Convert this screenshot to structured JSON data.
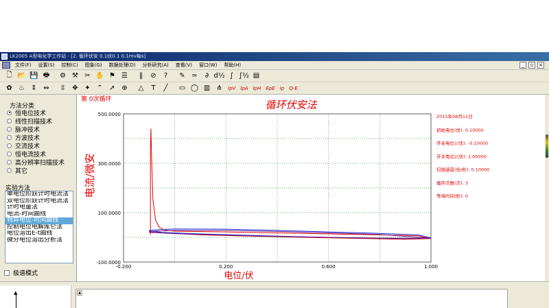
{
  "window": {
    "title": "LK2005 A型电化学工作站 - [2. 循环伏安  0.1伏0.1 0.1mv每s]"
  },
  "menu": [
    "文件(F)",
    "设置(S)",
    "控制(C)",
    "图象(G)",
    "数据处理(D)",
    "分析研究(A)",
    "查看(V)",
    "窗口(W)",
    "帮助(H)"
  ],
  "window_controls": [
    "_",
    "▫",
    "×"
  ],
  "toolbar1": [
    {
      "name": "new-file-icon",
      "glyph": "🗋"
    },
    {
      "name": "open-folder-icon",
      "glyph": "📂"
    },
    {
      "name": "save-icon",
      "glyph": "💾"
    },
    {
      "name": "print-icon",
      "glyph": "🖶"
    },
    {
      "name": "settings-icon",
      "glyph": "⚙"
    },
    {
      "name": "parameter-icon",
      "glyph": "⚒"
    },
    {
      "name": "tools-icon",
      "glyph": "✂"
    },
    {
      "name": "hand-icon",
      "glyph": "✋"
    },
    {
      "name": "flag-icon",
      "glyph": "⚑"
    },
    {
      "name": "runner-icon",
      "glyph": "☰"
    },
    {
      "name": "pause-icon",
      "glyph": "‖"
    },
    {
      "name": "stop-icon",
      "glyph": "⊘"
    },
    {
      "name": "help-icon",
      "glyph": "?"
    },
    {
      "name": "pen-icon",
      "glyph": "✎"
    },
    {
      "name": "smooth-icon",
      "glyph": "≃"
    },
    {
      "name": "derivative-icon",
      "glyph": "∂"
    },
    {
      "name": "half-derivative-icon",
      "glyph": "d½"
    },
    {
      "name": "integral-icon",
      "glyph": "∫"
    },
    {
      "name": "half-integral-icon",
      "glyph": "∫½"
    },
    {
      "name": "monitor-icon",
      "glyph": "▤"
    }
  ],
  "toolbar2": [
    {
      "name": "palette-icon",
      "glyph": "✿"
    },
    {
      "name": "lamp-icon",
      "glyph": "♨"
    },
    {
      "name": "axis-icon",
      "glyph": "⇕"
    },
    {
      "name": "move-horizontal-icon",
      "glyph": "⇔"
    },
    {
      "name": "move-vertical-icon",
      "glyph": "⇳"
    },
    {
      "name": "zoom-in-icon",
      "glyph": "✥"
    },
    {
      "name": "star-icon",
      "glyph": "✦"
    },
    {
      "name": "peak-icon",
      "glyph": "⌃"
    },
    {
      "name": "cursor-arrow-icon",
      "glyph": "➚"
    },
    {
      "name": "target-icon",
      "glyph": "⊕"
    },
    {
      "name": "triangle-icon",
      "glyph": "△"
    },
    {
      "name": "text-tool-icon",
      "glyph": "T"
    },
    {
      "name": "line-tool-icon",
      "glyph": "╱"
    },
    {
      "name": "rectangle-tool-icon",
      "glyph": "▭"
    },
    {
      "name": "ellipse-tool-icon",
      "glyph": "◯"
    },
    {
      "name": "chart-icon",
      "glyph": "▥"
    },
    {
      "name": "peak-find-icon",
      "glyph": "⋔"
    }
  ],
  "toolbar2_text_buttons": [
    "IpV",
    "IpA",
    "IpH",
    "EpE",
    "Ip",
    "Q-E"
  ],
  "left_panel": {
    "method_category_label": "方法分类",
    "method_categories": [
      {
        "label": "恒电位技术",
        "selected": true
      },
      {
        "label": "线性扫描技术",
        "selected": false
      },
      {
        "label": "脉冲技术",
        "selected": false
      },
      {
        "label": "方波技术",
        "selected": false
      },
      {
        "label": "交流技术",
        "selected": false
      },
      {
        "label": "恒电流技术",
        "selected": false
      },
      {
        "label": "高分辨率扫描技术",
        "selected": false
      },
      {
        "label": "其它",
        "selected": false
      }
    ],
    "experiment_label": "实验方法",
    "experiments": [
      {
        "label": "单电位阶跃计时电流法",
        "selected": false
      },
      {
        "label": "双电位阶跃计时电流法",
        "selected": false
      },
      {
        "label": "计时电量法",
        "selected": false
      },
      {
        "label": "电流-时间曲线",
        "selected": false
      },
      {
        "label": "特异电位-时间曲线",
        "selected": true
      },
      {
        "label": "控制电位电解库仑法",
        "selected": false
      },
      {
        "label": "电位溶出E-t曲线",
        "selected": false
      },
      {
        "label": "微分电位溶出分析法",
        "selected": false
      }
    ],
    "pole_mode_label": "极谱模式",
    "pole_mode_checked": false
  },
  "plot": {
    "cycle_label": "第 0次循环",
    "colors": {
      "red": "#e00000",
      "blue": "#1a2adb",
      "purple": "#6a1a8a",
      "grid": "#3a8a3a"
    }
  },
  "params": {
    "date": "2015年08月11日",
    "lines": [
      "初始电位(伏): 0.10000",
      "开关电位1(伏): -0.10000",
      "开关电位2(伏): 1.00000",
      "扫描速度(伏/秒): 0.10000",
      "循环次数(次): 3",
      "等待时间(秒): 0"
    ]
  },
  "chart_data": {
    "type": "line",
    "title": "循环伏安法",
    "xlabel": "电位/伏",
    "ylabel": "电流/微安",
    "xlim": [
      -0.2,
      1.0
    ],
    "ylim": [
      -100,
      500
    ],
    "x_ticks": [
      "-0.200",
      "0.200",
      "0.600",
      "1.000"
    ],
    "y_ticks": [
      "500.0000",
      "300.0000",
      "100.0000",
      "-100.0000"
    ],
    "grid": true,
    "series": [
      {
        "color": "#e00000",
        "points": [
          [
            -0.095,
            10
          ],
          [
            -0.095,
            20
          ],
          [
            -0.095,
            360
          ],
          [
            -0.093,
            440
          ],
          [
            -0.09,
            300
          ],
          [
            -0.085,
            150
          ],
          [
            -0.075,
            70
          ],
          [
            -0.06,
            40
          ],
          [
            -0.04,
            30
          ],
          [
            0.0,
            25
          ],
          [
            0.2,
            22
          ],
          [
            0.4,
            18
          ],
          [
            0.6,
            14
          ],
          [
            0.8,
            10
          ],
          [
            0.95,
            6
          ],
          [
            1.0,
            -5
          ],
          [
            0.9,
            -8
          ],
          [
            0.7,
            -4
          ],
          [
            0.5,
            0
          ],
          [
            0.3,
            5
          ],
          [
            0.1,
            10
          ],
          [
            -0.05,
            18
          ],
          [
            -0.1,
            22
          ]
        ]
      },
      {
        "color": "#1a2adb",
        "points": [
          [
            -0.1,
            28
          ],
          [
            -0.05,
            32
          ],
          [
            0.0,
            34
          ],
          [
            0.2,
            33
          ],
          [
            0.4,
            28
          ],
          [
            0.6,
            22
          ],
          [
            0.8,
            16
          ],
          [
            0.95,
            10
          ],
          [
            1.0,
            -2
          ],
          [
            0.9,
            -5
          ],
          [
            0.7,
            -2
          ],
          [
            0.5,
            2
          ],
          [
            0.3,
            8
          ],
          [
            0.1,
            14
          ],
          [
            -0.05,
            20
          ],
          [
            -0.1,
            26
          ]
        ]
      },
      {
        "color": "#6a1a8a",
        "points": [
          [
            -0.1,
            24
          ],
          [
            0.0,
            28
          ],
          [
            0.2,
            28
          ],
          [
            0.4,
            24
          ],
          [
            0.6,
            18
          ],
          [
            0.8,
            12
          ],
          [
            1.0,
            -4
          ],
          [
            0.8,
            -3
          ],
          [
            0.6,
            0
          ],
          [
            0.4,
            4
          ],
          [
            0.2,
            9
          ],
          [
            0.0,
            15
          ],
          [
            -0.1,
            20
          ]
        ]
      }
    ]
  }
}
